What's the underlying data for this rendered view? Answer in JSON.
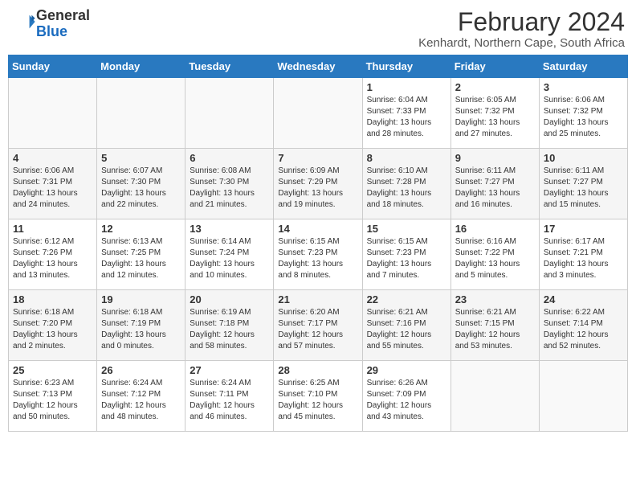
{
  "header": {
    "logo_general": "General",
    "logo_blue": "Blue",
    "month_year": "February 2024",
    "location": "Kenhardt, Northern Cape, South Africa"
  },
  "days_of_week": [
    "Sunday",
    "Monday",
    "Tuesday",
    "Wednesday",
    "Thursday",
    "Friday",
    "Saturday"
  ],
  "weeks": [
    [
      {
        "day": "",
        "info": ""
      },
      {
        "day": "",
        "info": ""
      },
      {
        "day": "",
        "info": ""
      },
      {
        "day": "",
        "info": ""
      },
      {
        "day": "1",
        "info": "Sunrise: 6:04 AM\nSunset: 7:33 PM\nDaylight: 13 hours\nand 28 minutes."
      },
      {
        "day": "2",
        "info": "Sunrise: 6:05 AM\nSunset: 7:32 PM\nDaylight: 13 hours\nand 27 minutes."
      },
      {
        "day": "3",
        "info": "Sunrise: 6:06 AM\nSunset: 7:32 PM\nDaylight: 13 hours\nand 25 minutes."
      }
    ],
    [
      {
        "day": "4",
        "info": "Sunrise: 6:06 AM\nSunset: 7:31 PM\nDaylight: 13 hours\nand 24 minutes."
      },
      {
        "day": "5",
        "info": "Sunrise: 6:07 AM\nSunset: 7:30 PM\nDaylight: 13 hours\nand 22 minutes."
      },
      {
        "day": "6",
        "info": "Sunrise: 6:08 AM\nSunset: 7:30 PM\nDaylight: 13 hours\nand 21 minutes."
      },
      {
        "day": "7",
        "info": "Sunrise: 6:09 AM\nSunset: 7:29 PM\nDaylight: 13 hours\nand 19 minutes."
      },
      {
        "day": "8",
        "info": "Sunrise: 6:10 AM\nSunset: 7:28 PM\nDaylight: 13 hours\nand 18 minutes."
      },
      {
        "day": "9",
        "info": "Sunrise: 6:11 AM\nSunset: 7:27 PM\nDaylight: 13 hours\nand 16 minutes."
      },
      {
        "day": "10",
        "info": "Sunrise: 6:11 AM\nSunset: 7:27 PM\nDaylight: 13 hours\nand 15 minutes."
      }
    ],
    [
      {
        "day": "11",
        "info": "Sunrise: 6:12 AM\nSunset: 7:26 PM\nDaylight: 13 hours\nand 13 minutes."
      },
      {
        "day": "12",
        "info": "Sunrise: 6:13 AM\nSunset: 7:25 PM\nDaylight: 13 hours\nand 12 minutes."
      },
      {
        "day": "13",
        "info": "Sunrise: 6:14 AM\nSunset: 7:24 PM\nDaylight: 13 hours\nand 10 minutes."
      },
      {
        "day": "14",
        "info": "Sunrise: 6:15 AM\nSunset: 7:23 PM\nDaylight: 13 hours\nand 8 minutes."
      },
      {
        "day": "15",
        "info": "Sunrise: 6:15 AM\nSunset: 7:23 PM\nDaylight: 13 hours\nand 7 minutes."
      },
      {
        "day": "16",
        "info": "Sunrise: 6:16 AM\nSunset: 7:22 PM\nDaylight: 13 hours\nand 5 minutes."
      },
      {
        "day": "17",
        "info": "Sunrise: 6:17 AM\nSunset: 7:21 PM\nDaylight: 13 hours\nand 3 minutes."
      }
    ],
    [
      {
        "day": "18",
        "info": "Sunrise: 6:18 AM\nSunset: 7:20 PM\nDaylight: 13 hours\nand 2 minutes."
      },
      {
        "day": "19",
        "info": "Sunrise: 6:18 AM\nSunset: 7:19 PM\nDaylight: 13 hours\nand 0 minutes."
      },
      {
        "day": "20",
        "info": "Sunrise: 6:19 AM\nSunset: 7:18 PM\nDaylight: 12 hours\nand 58 minutes."
      },
      {
        "day": "21",
        "info": "Sunrise: 6:20 AM\nSunset: 7:17 PM\nDaylight: 12 hours\nand 57 minutes."
      },
      {
        "day": "22",
        "info": "Sunrise: 6:21 AM\nSunset: 7:16 PM\nDaylight: 12 hours\nand 55 minutes."
      },
      {
        "day": "23",
        "info": "Sunrise: 6:21 AM\nSunset: 7:15 PM\nDaylight: 12 hours\nand 53 minutes."
      },
      {
        "day": "24",
        "info": "Sunrise: 6:22 AM\nSunset: 7:14 PM\nDaylight: 12 hours\nand 52 minutes."
      }
    ],
    [
      {
        "day": "25",
        "info": "Sunrise: 6:23 AM\nSunset: 7:13 PM\nDaylight: 12 hours\nand 50 minutes."
      },
      {
        "day": "26",
        "info": "Sunrise: 6:24 AM\nSunset: 7:12 PM\nDaylight: 12 hours\nand 48 minutes."
      },
      {
        "day": "27",
        "info": "Sunrise: 6:24 AM\nSunset: 7:11 PM\nDaylight: 12 hours\nand 46 minutes."
      },
      {
        "day": "28",
        "info": "Sunrise: 6:25 AM\nSunset: 7:10 PM\nDaylight: 12 hours\nand 45 minutes."
      },
      {
        "day": "29",
        "info": "Sunrise: 6:26 AM\nSunset: 7:09 PM\nDaylight: 12 hours\nand 43 minutes."
      },
      {
        "day": "",
        "info": ""
      },
      {
        "day": "",
        "info": ""
      }
    ]
  ]
}
